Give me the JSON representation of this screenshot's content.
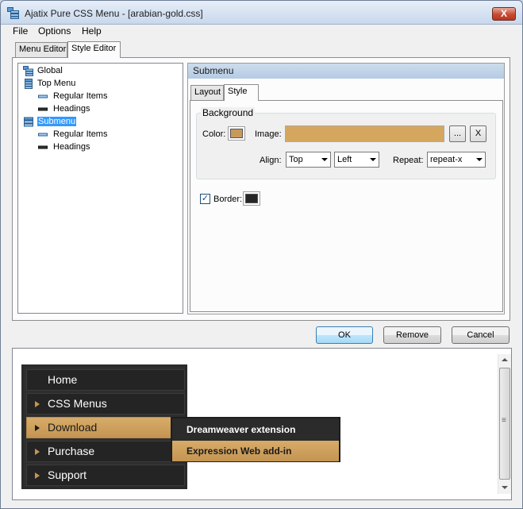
{
  "window": {
    "title": "Ajatix Pure CSS Menu - [arabian-gold.css]",
    "close_label": "X"
  },
  "menubar": [
    "File",
    "Options",
    "Help"
  ],
  "main_tabs": [
    {
      "label": "Menu Editor"
    },
    {
      "label": "Style Editor"
    }
  ],
  "tree": [
    {
      "label": "Global",
      "level": 0,
      "icon": "menu-tree-icon"
    },
    {
      "label": "Top Menu",
      "level": 0,
      "icon": "menu-tree-icon"
    },
    {
      "label": "Regular Items",
      "level": 1,
      "icon": "item-icon"
    },
    {
      "label": "Headings",
      "level": 1,
      "icon": "heading-icon"
    },
    {
      "label": "Submenu",
      "level": 0,
      "icon": "menu-tree-icon",
      "selected": true
    },
    {
      "label": "Regular Items",
      "level": 1,
      "icon": "item-icon"
    },
    {
      "label": "Headings",
      "level": 1,
      "icon": "heading-icon"
    }
  ],
  "panel": {
    "header": "Submenu",
    "tabs": [
      {
        "label": "Layout"
      },
      {
        "label": "Style"
      }
    ],
    "background": {
      "group_title": "Background",
      "color_label": "Color:",
      "color_value": "#c9995a",
      "image_label": "Image:",
      "image_color": "#d4a65e",
      "browse_label": "...",
      "clear_label": "X",
      "align_label": "Align:",
      "align_v": "Top",
      "align_h": "Left",
      "repeat_label": "Repeat:",
      "repeat_value": "repeat-x"
    },
    "border": {
      "checked_mark": "✓",
      "label": "Border:",
      "color_value": "#262626"
    }
  },
  "buttons": {
    "ok": "OK",
    "remove": "Remove",
    "cancel": "Cancel"
  },
  "preview": {
    "menu_items": [
      {
        "label": "Home",
        "has_arrow": false
      },
      {
        "label": "CSS Menus",
        "has_arrow": true
      },
      {
        "label": "Download",
        "has_arrow": true,
        "active": true
      },
      {
        "label": "Purchase",
        "has_arrow": true
      },
      {
        "label": "Support",
        "has_arrow": true
      }
    ],
    "submenu_items": [
      {
        "label": "Dreamweaver extension",
        "active": false
      },
      {
        "label": "Expression Web add-in",
        "active": true
      }
    ],
    "scroll_grip": "≡"
  },
  "colors": {
    "gold": "#d4a65e",
    "dark": "#2b2b2b",
    "selection": "#3399ff"
  }
}
